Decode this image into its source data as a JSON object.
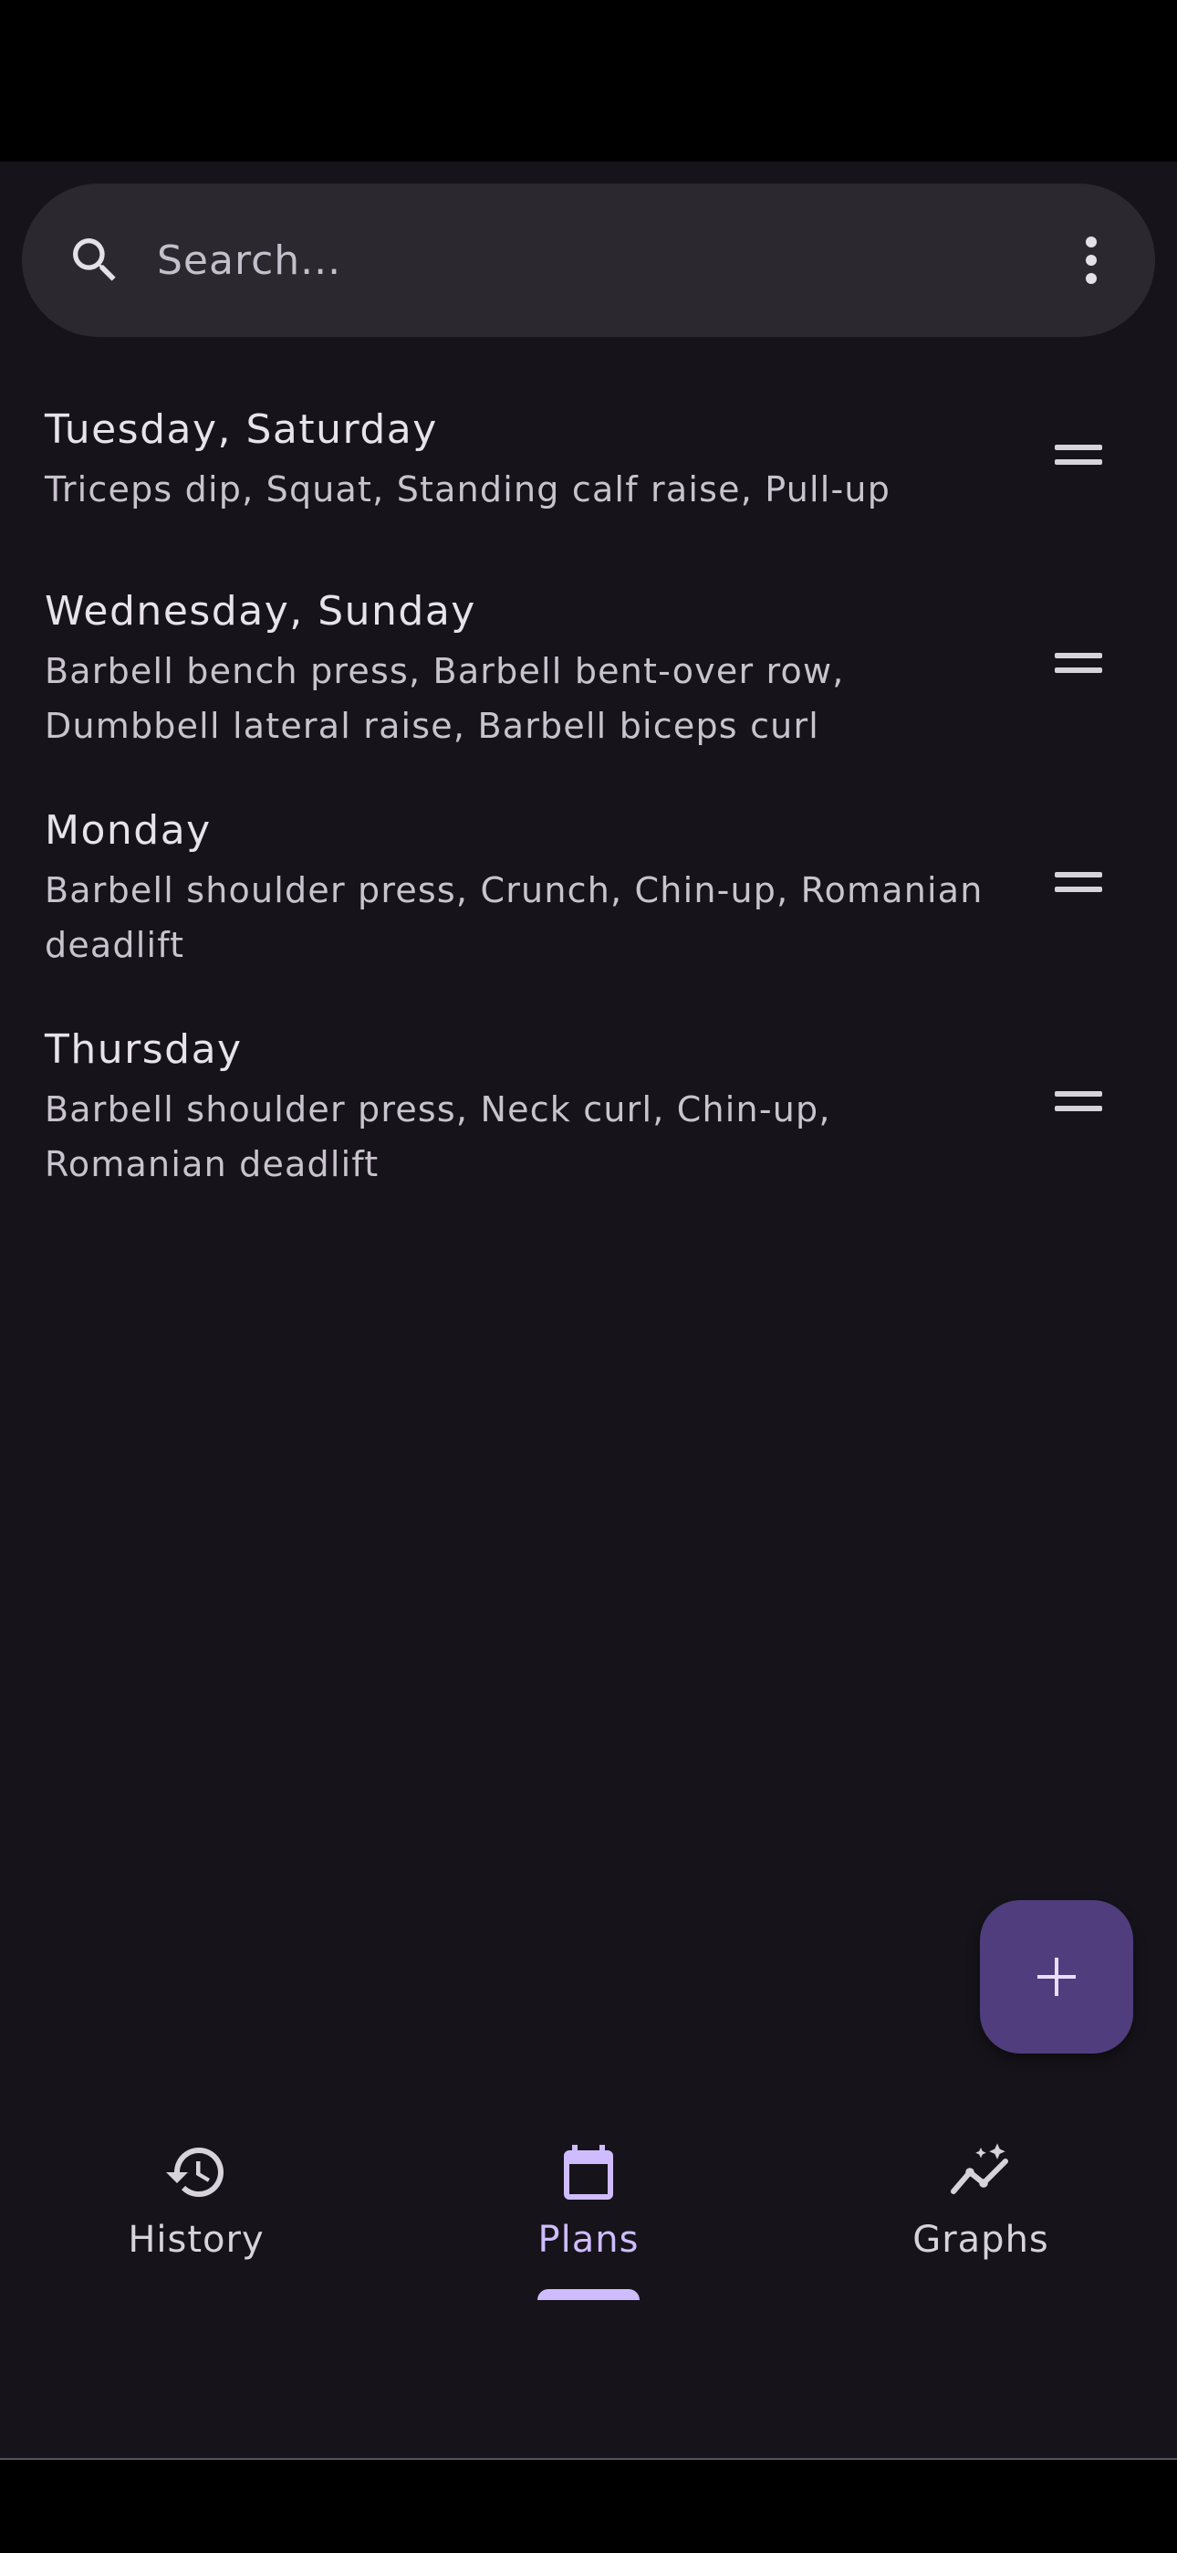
{
  "search": {
    "placeholder": "Search..."
  },
  "plans": [
    {
      "title": "Tuesday, Saturday",
      "exercises": "Triceps dip,  Squat, Standing calf raise, Pull-up"
    },
    {
      "title": "Wednesday, Sunday",
      "exercises": "Barbell bench press, Barbell bent-over row, Dumbbell lateral raise, Barbell biceps curl"
    },
    {
      "title": "Monday",
      "exercises": "Barbell shoulder press, Crunch, Chin-up, Romanian deadlift"
    },
    {
      "title": "Thursday",
      "exercises": "Barbell shoulder press, Neck curl, Chin-up, Romanian deadlift"
    }
  ],
  "fab": {
    "icon": "plus-icon"
  },
  "bottom_nav": {
    "items": [
      {
        "label": "History",
        "icon": "history-icon",
        "active": false
      },
      {
        "label": "Plans",
        "icon": "calendar-icon",
        "active": true
      },
      {
        "label": "Graphs",
        "icon": "graph-icon",
        "active": false
      }
    ]
  },
  "colors": {
    "background": "#16141a",
    "search_bar": "#2b292f",
    "accent": "#cfbcff",
    "fab": "#4f3d7e"
  }
}
